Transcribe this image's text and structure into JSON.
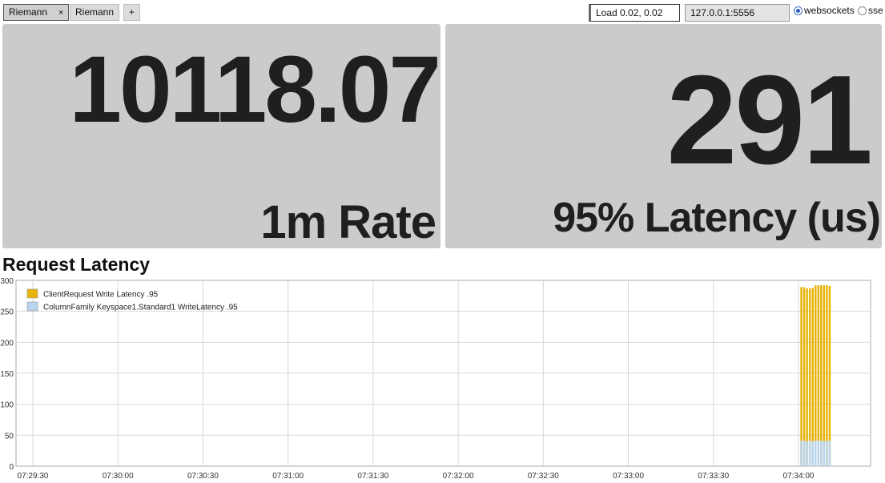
{
  "tabs": [
    {
      "label": "Riemann",
      "close": "×",
      "active": true
    },
    {
      "label": "Riemann",
      "active": false
    }
  ],
  "add_tab_label": "+",
  "load_value": "Load 0.02, 0.02",
  "server_value": "127.0.0.1:5556",
  "transport": {
    "options": [
      {
        "label": "websockets",
        "selected": true
      },
      {
        "label": "sse",
        "selected": false
      }
    ]
  },
  "panels": [
    {
      "value": "10118.07",
      "label": "1m Rate"
    },
    {
      "value": "291",
      "label": "95% Latency (us)"
    }
  ],
  "chart_title": "Request Latency",
  "colors": {
    "panel_bg": "#cbcbcb",
    "series_write": "#e8b30c",
    "series_cf": "#b8d4ee"
  },
  "chart_data": {
    "type": "bar",
    "title": "Request Latency",
    "ylim": [
      0,
      300
    ],
    "yticks": [
      0,
      50,
      100,
      150,
      200,
      250,
      300
    ],
    "xticks": [
      "07:29:30",
      "07:30:00",
      "07:30:30",
      "07:31:00",
      "07:31:30",
      "07:32:00",
      "07:32:30",
      "07:33:00",
      "07:33:30",
      "07:34:00"
    ],
    "grid": true,
    "legend_position": "top-left",
    "series": [
      {
        "name": "ClientRequest Write Latency .95",
        "color": "#e8b30c",
        "times": [
          "07:34:01",
          "07:34:02",
          "07:34:03",
          "07:34:04",
          "07:34:05",
          "07:34:06",
          "07:34:07",
          "07:34:08",
          "07:34:09",
          "07:34:10",
          "07:34:11"
        ],
        "values": [
          289,
          289,
          287,
          287,
          288,
          292,
          292,
          292,
          292,
          292,
          291
        ]
      },
      {
        "name": "ColumnFamily Keyspace1.Standard1 WriteLatency .95",
        "color": "#b8d4ee",
        "times": [
          "07:34:01",
          "07:34:02",
          "07:34:03",
          "07:34:04",
          "07:34:05",
          "07:34:06",
          "07:34:07",
          "07:34:08",
          "07:34:09",
          "07:34:10",
          "07:34:11"
        ],
        "values": [
          41,
          41,
          40,
          41,
          40,
          41,
          41,
          41,
          40,
          41,
          41
        ]
      }
    ]
  }
}
